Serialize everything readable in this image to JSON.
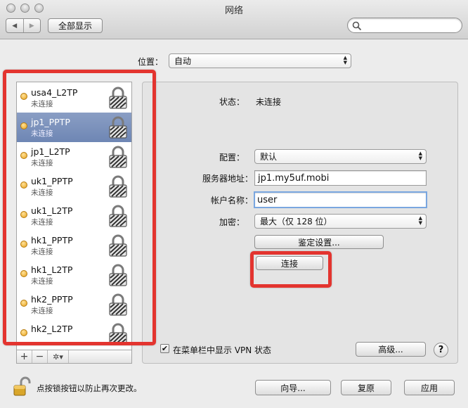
{
  "window": {
    "title": "网络"
  },
  "toolbar": {
    "back": "◀",
    "forward": "▶",
    "show_all": "全部显示",
    "search_placeholder": ""
  },
  "location": {
    "label": "位置：",
    "value": "自动"
  },
  "connections": [
    {
      "name": "usa4_L2TP",
      "status": "未连接",
      "selected": false
    },
    {
      "name": "jp1_PPTP",
      "status": "未连接",
      "selected": true
    },
    {
      "name": "jp1_L2TP",
      "status": "未连接",
      "selected": false
    },
    {
      "name": "uk1_PPTP",
      "status": "未连接",
      "selected": false
    },
    {
      "name": "uk1_L2TP",
      "status": "未连接",
      "selected": false
    },
    {
      "name": "hk1_PPTP",
      "status": "未连接",
      "selected": false
    },
    {
      "name": "hk1_L2TP",
      "status": "未连接",
      "selected": false
    },
    {
      "name": "hk2_PPTP",
      "status": "未连接",
      "selected": false
    },
    {
      "name": "hk2_L2TP",
      "status": "",
      "selected": false
    }
  ],
  "list_controls": {
    "add": "+",
    "remove": "−",
    "gear": "✲▾"
  },
  "detail": {
    "status_label": "状态：",
    "status_value": "未连接",
    "config_label": "配置：",
    "config_value": "默认",
    "server_label": "服务器地址：",
    "server_value": "jp1.my5uf.mobi",
    "account_label": "帐户名称：",
    "account_value": "user",
    "encryption_label": "加密：",
    "encryption_value": "最大（仅 128 位）",
    "auth_button": "鉴定设置...",
    "connect_button": "连接",
    "show_vpn_label": "在菜单栏中显示 VPN 状态",
    "show_vpn_checked": "✔",
    "advanced_button": "高级...",
    "help": "?"
  },
  "footer": {
    "lock_text": "点按锁按钮以防止再次更改。",
    "assist_button": "向导...",
    "revert_button": "复原",
    "apply_button": "应用"
  },
  "colors": {
    "highlight": "#e3342f",
    "selection": "#7a90bc",
    "status_dot": "#f0b030"
  }
}
